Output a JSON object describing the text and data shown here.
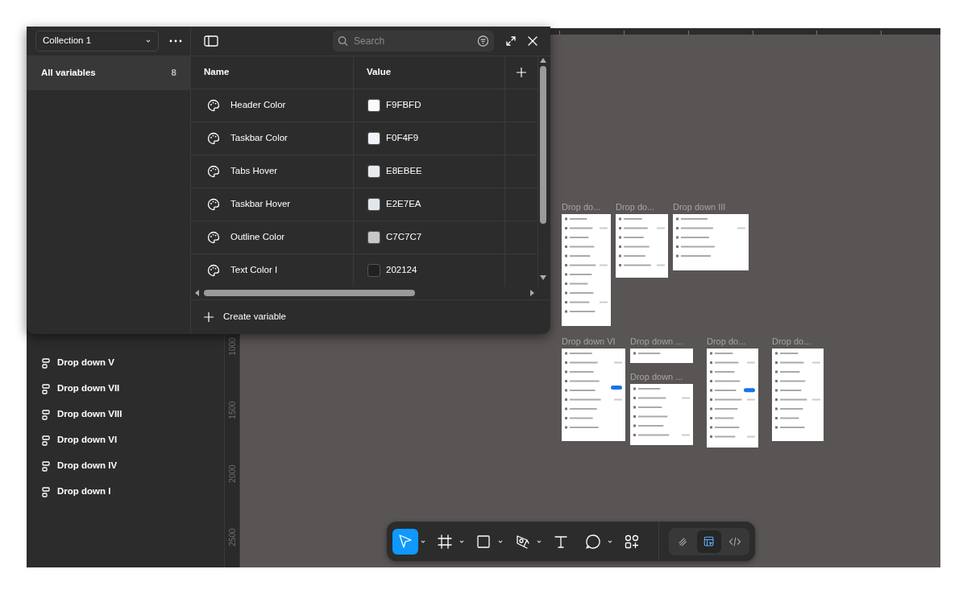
{
  "variables_panel": {
    "collection": "Collection 1",
    "groups": [
      {
        "label": "All variables",
        "count": "8",
        "selected": true
      }
    ],
    "search": {
      "placeholder": "Search"
    },
    "columns": [
      "Name",
      "Value"
    ],
    "rows": [
      {
        "name": "Header Color",
        "value": "F9FBFD",
        "color": "#f9fbfd"
      },
      {
        "name": "Taskbar Color",
        "value": "F0F4F9",
        "color": "#f0f4f9"
      },
      {
        "name": "Tabs Hover",
        "value": "E8EBEE",
        "color": "#e8ebee"
      },
      {
        "name": "Taskbar Hover",
        "value": "E2E7EA",
        "color": "#e2e7ea"
      },
      {
        "name": "Outline Color",
        "value": "C7C7C7",
        "color": "#c7c7c7"
      },
      {
        "name": "Text Color I",
        "value": "202124",
        "color": "#202124"
      }
    ],
    "create_label": "Create variable"
  },
  "layers": [
    {
      "label": "Drop down V"
    },
    {
      "label": "Drop down VII"
    },
    {
      "label": "Drop down VIII"
    },
    {
      "label": "Drop down VI"
    },
    {
      "label": "Drop down IV"
    },
    {
      "label": "Drop down I"
    }
  ],
  "ruler_labels": [
    "1000",
    "1500",
    "2000",
    "2500"
  ],
  "frame_rows": [
    [
      [
        {
          "label": "Drop do..."
        }
      ],
      [
        {
          "label": "Drop do..."
        }
      ],
      [
        {
          "label": "Drop down III"
        }
      ]
    ],
    [
      [
        {
          "label": "Drop down VI"
        }
      ],
      [
        {
          "label": "Drop down ..."
        },
        {
          "label": "Drop down ..."
        }
      ],
      [
        {
          "label": "Drop do..."
        }
      ],
      [
        {
          "label": "Drop do..."
        }
      ]
    ]
  ],
  "toolbar": {
    "tools": [
      {
        "kind": "move",
        "selected": true,
        "menu": true
      },
      {
        "kind": "frame",
        "selected": false,
        "menu": true
      },
      {
        "kind": "rectangle",
        "selected": false,
        "menu": true
      },
      {
        "kind": "pen",
        "selected": false,
        "menu": true
      },
      {
        "kind": "text",
        "selected": false,
        "menu": false
      },
      {
        "kind": "comment",
        "selected": false,
        "menu": true
      },
      {
        "kind": "assets",
        "selected": false,
        "menu": false
      }
    ],
    "modes": [
      {
        "kind": "draw",
        "selected": false
      },
      {
        "kind": "design",
        "selected": true
      },
      {
        "kind": "dev",
        "selected": false
      }
    ]
  }
}
